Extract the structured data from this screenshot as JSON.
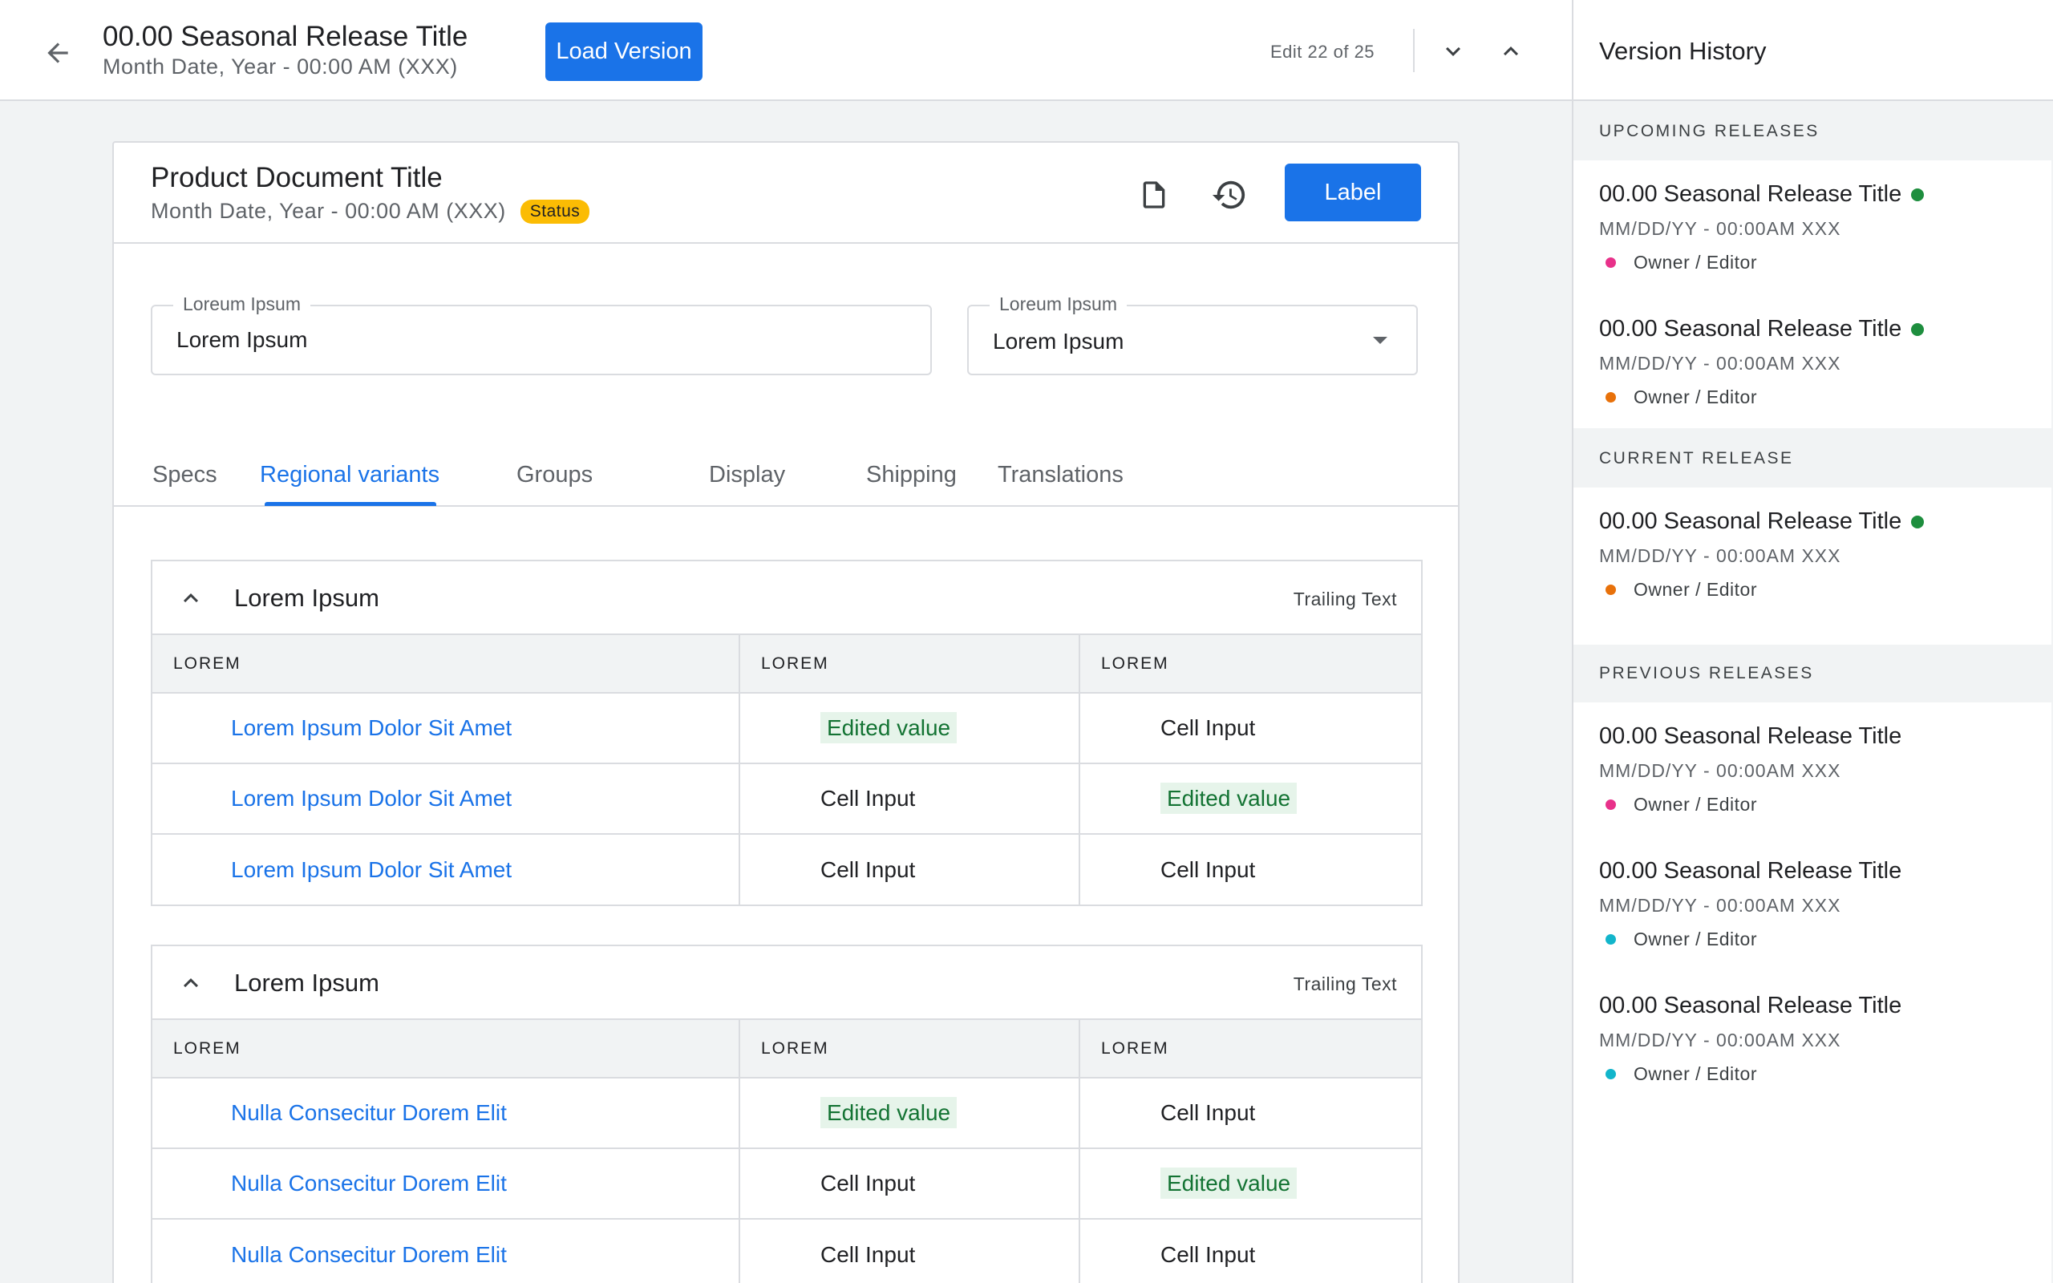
{
  "header": {
    "title": "00.00 Seasonal Release Title",
    "subtitle": "Month Date, Year - 00:00 AM (XXX)",
    "load_button": "Load Version",
    "edit_count": "Edit 22 of 25"
  },
  "card": {
    "title": "Product Document Title",
    "subtitle": "Month Date, Year - 00:00 AM (XXX)",
    "status": "Status",
    "label_button": "Label"
  },
  "fields": {
    "text_field": {
      "label": "Loreum Ipsum",
      "value": "Lorem Ipsum"
    },
    "select_field": {
      "label": "Loreum Ipsum",
      "value": "Lorem Ipsum"
    }
  },
  "tabs": [
    "Specs",
    "Regional variants",
    "Groups",
    "Display",
    "Shipping",
    "Translations"
  ],
  "active_tab": "Regional variants",
  "groups": [
    {
      "title": "Lorem Ipsum",
      "trailing": "Trailing Text",
      "columns": [
        "LOREM",
        "LOREM",
        "LOREM"
      ],
      "rows": [
        {
          "name": "Lorem Ipsum Dolor Sit Amet",
          "col2": "Edited value",
          "col2_edited": true,
          "col3": "Cell Input",
          "col3_edited": false
        },
        {
          "name": "Lorem Ipsum Dolor Sit Amet",
          "col2": "Cell Input",
          "col2_edited": false,
          "col3": "Edited value",
          "col3_edited": true
        },
        {
          "name": "Lorem Ipsum Dolor Sit Amet",
          "col2": "Cell Input",
          "col2_edited": false,
          "col3": "Cell Input",
          "col3_edited": false
        }
      ]
    },
    {
      "title": "Lorem Ipsum",
      "trailing": "Trailing Text",
      "columns": [
        "LOREM",
        "LOREM",
        "LOREM"
      ],
      "rows": [
        {
          "name": "Nulla Consecitur Dorem Elit",
          "col2": "Edited value",
          "col2_edited": true,
          "col3": "Cell Input",
          "col3_edited": false
        },
        {
          "name": "Nulla Consecitur Dorem Elit",
          "col2": "Cell Input",
          "col2_edited": false,
          "col3": "Edited value",
          "col3_edited": true
        },
        {
          "name": "Nulla Consecitur Dorem Elit",
          "col2": "Cell Input",
          "col2_edited": false,
          "col3": "Cell Input",
          "col3_edited": false
        }
      ]
    }
  ],
  "version_history": {
    "title": "Version History",
    "sections": {
      "upcoming": {
        "label": "UPCOMING RELEASES",
        "items": [
          {
            "title": "00.00 Seasonal Release Title",
            "live": true,
            "date": "MM/DD/YY - 00:00AM XXX",
            "owner": "Owner / Editor",
            "owner_color": "#e8318a"
          },
          {
            "title": "00.00 Seasonal Release Title",
            "live": true,
            "date": "MM/DD/YY - 00:00AM XXX",
            "owner": "Owner / Editor",
            "owner_color": "#e8710a"
          }
        ]
      },
      "current": {
        "label": "CURRENT RELEASE",
        "items": [
          {
            "title": "00.00 Seasonal Release Title",
            "live": true,
            "date": "MM/DD/YY - 00:00AM XXX",
            "owner": "Owner / Editor",
            "owner_color": "#e8710a"
          }
        ]
      },
      "previous": {
        "label": "PREVIOUS RELEASES",
        "items": [
          {
            "title": "00.00 Seasonal Release Title",
            "live": false,
            "date": "MM/DD/YY - 00:00AM XXX",
            "owner": "Owner / Editor",
            "owner_color": "#e8318a"
          },
          {
            "title": "00.00 Seasonal Release Title",
            "live": false,
            "date": "MM/DD/YY - 00:00AM XXX",
            "owner": "Owner / Editor",
            "owner_color": "#12b5cb"
          },
          {
            "title": "00.00 Seasonal Release Title",
            "live": false,
            "date": "MM/DD/YY - 00:00AM XXX",
            "owner": "Owner / Editor",
            "owner_color": "#12b5cb"
          }
        ]
      }
    }
  },
  "colors": {
    "accent": "#1a73e8",
    "live": "#1e8e3e",
    "status": "#fbbc04",
    "edited_bg": "#e6f4ea",
    "edited_text": "#137333"
  }
}
